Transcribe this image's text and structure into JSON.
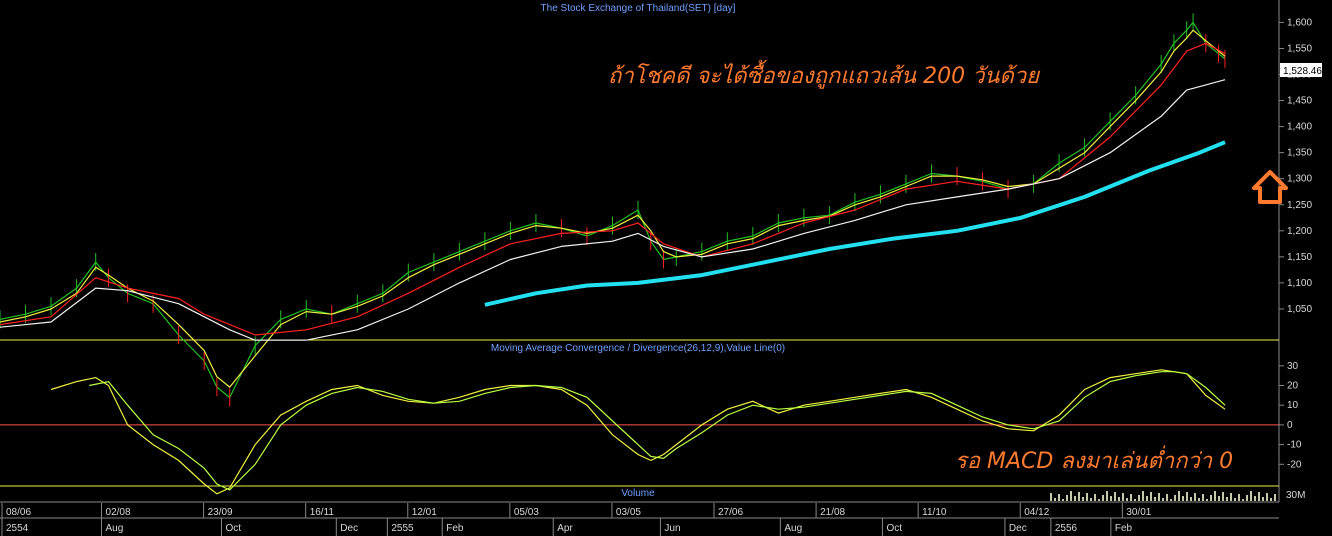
{
  "panels": {
    "price_title": "The Stock Exchange of Thailand(SET) [day]",
    "macd_title": "Moving Average Convergence / Divergence(26,12,9),Value Line(0)",
    "volume_title": "Volume"
  },
  "current_value_label": "1,528.46",
  "annotations": {
    "price_note": "ถ้าโชคดี จะได้ซื้อของถูกแถวเส้น 200 วันด้วย",
    "macd_note": "รอ MACD ลงมาเล่นต่ำกว่า 0"
  },
  "colors": {
    "annotation": "#ff7a2e",
    "ma200": "#22e0f0",
    "ma_white": "#f2f2f2",
    "ma_red": "#ff2020",
    "ma_yellow": "#f0f040",
    "candle_up": "#22c022",
    "candle_down": "#ff2020",
    "macd": "#f0f040",
    "signal": "#b8ff40",
    "zero_line": "#ff5050",
    "title": "#6fa0ff"
  },
  "chart_data": {
    "type": "line",
    "price_axis": {
      "ticks": [
        "1,600",
        "1,550",
        "1,500",
        "1,450",
        "1,400",
        "1,350",
        "1,300",
        "1,250",
        "1,200",
        "1,150",
        "1,100",
        "1,050"
      ],
      "tick_values": [
        1600,
        1550,
        1500,
        1450,
        1400,
        1350,
        1300,
        1250,
        1200,
        1150,
        1100,
        1050
      ],
      "range": [
        1000,
        1620
      ]
    },
    "macd_axis": {
      "ticks": [
        "30",
        "20",
        "10",
        "0",
        "-10",
        "-20"
      ],
      "tick_values": [
        30,
        20,
        10,
        0,
        -10,
        -20
      ],
      "range": [
        -30,
        36
      ]
    },
    "volume_axis": {
      "ticks": [
        "30M"
      ]
    },
    "date_labels_top": [
      "08/06",
      "02/08",
      "23/09",
      "16/11",
      "12/01",
      "05/03",
      "03/05",
      "27/06",
      "21/08",
      "11/10",
      "04/12",
      "30/01"
    ],
    "date_labels_bottom": [
      "2554",
      "Aug",
      "Oct",
      "Dec",
      "2555",
      "Feb",
      "Apr",
      "Jun",
      "Aug",
      "Oct",
      "Dec",
      "2556",
      "Feb"
    ],
    "date_top_pos": [
      0.0,
      0.078,
      0.158,
      0.238,
      0.318,
      0.398,
      0.478,
      0.558,
      0.638,
      0.718,
      0.798,
      0.878
    ],
    "date_bottom_pos": [
      0.0,
      0.078,
      0.172,
      0.262,
      0.302,
      0.345,
      0.432,
      0.516,
      0.61,
      0.69,
      0.786,
      0.822,
      0.869
    ],
    "price_series": [
      {
        "name": "SET close",
        "t": [
          0,
          0.02,
          0.04,
          0.06,
          0.075,
          0.085,
          0.1,
          0.12,
          0.14,
          0.16,
          0.17,
          0.18,
          0.2,
          0.22,
          0.24,
          0.26,
          0.28,
          0.3,
          0.32,
          0.34,
          0.36,
          0.38,
          0.4,
          0.42,
          0.44,
          0.46,
          0.48,
          0.5,
          0.51,
          0.52,
          0.53,
          0.55,
          0.57,
          0.59,
          0.61,
          0.63,
          0.65,
          0.67,
          0.69,
          0.71,
          0.73,
          0.75,
          0.77,
          0.79,
          0.81,
          0.83,
          0.85,
          0.87,
          0.89,
          0.91,
          0.92,
          0.93,
          0.935,
          0.945,
          0.955,
          0.96
        ],
        "v": [
          1030,
          1040,
          1055,
          1090,
          1140,
          1110,
          1080,
          1060,
          1000,
          950,
          900,
          880,
          980,
          1030,
          1050,
          1040,
          1060,
          1080,
          1120,
          1140,
          1160,
          1180,
          1200,
          1215,
          1205,
          1190,
          1210,
          1240,
          1180,
          1145,
          1150,
          1160,
          1180,
          1190,
          1215,
          1225,
          1230,
          1255,
          1270,
          1290,
          1310,
          1305,
          1295,
          1280,
          1290,
          1330,
          1360,
          1410,
          1460,
          1520,
          1560,
          1585,
          1600,
          1560,
          1540,
          1530
        ]
      },
      {
        "name": "Fast MA",
        "t": [
          0,
          0.02,
          0.04,
          0.06,
          0.075,
          0.085,
          0.1,
          0.12,
          0.14,
          0.16,
          0.17,
          0.18,
          0.2,
          0.22,
          0.24,
          0.26,
          0.28,
          0.3,
          0.32,
          0.34,
          0.36,
          0.38,
          0.4,
          0.42,
          0.44,
          0.46,
          0.48,
          0.5,
          0.51,
          0.52,
          0.53,
          0.55,
          0.57,
          0.59,
          0.61,
          0.63,
          0.65,
          0.67,
          0.69,
          0.71,
          0.73,
          0.75,
          0.77,
          0.79,
          0.81,
          0.83,
          0.85,
          0.87,
          0.89,
          0.91,
          0.92,
          0.93,
          0.935,
          0.945,
          0.955,
          0.96
        ],
        "v": [
          1025,
          1035,
          1050,
          1080,
          1130,
          1115,
          1090,
          1065,
          1020,
          970,
          920,
          900,
          960,
          1020,
          1045,
          1040,
          1055,
          1075,
          1110,
          1135,
          1155,
          1175,
          1195,
          1210,
          1205,
          1195,
          1205,
          1230,
          1200,
          1160,
          1150,
          1155,
          1175,
          1185,
          1210,
          1220,
          1228,
          1250,
          1265,
          1285,
          1305,
          1305,
          1298,
          1285,
          1290,
          1320,
          1350,
          1400,
          1450,
          1505,
          1545,
          1570,
          1585,
          1565,
          1545,
          1535
        ]
      },
      {
        "name": "MA red",
        "t": [
          0,
          0.04,
          0.075,
          0.1,
          0.14,
          0.16,
          0.2,
          0.24,
          0.28,
          0.32,
          0.36,
          0.4,
          0.44,
          0.48,
          0.5,
          0.52,
          0.55,
          0.59,
          0.63,
          0.67,
          0.71,
          0.75,
          0.79,
          0.83,
          0.87,
          0.91,
          0.93,
          0.945,
          0.96
        ],
        "v": [
          1020,
          1035,
          1110,
          1090,
          1070,
          1040,
          1000,
          1010,
          1035,
          1080,
          1130,
          1175,
          1195,
          1200,
          1215,
          1175,
          1150,
          1175,
          1215,
          1240,
          1280,
          1295,
          1280,
          1300,
          1380,
          1480,
          1545,
          1560,
          1540
        ]
      },
      {
        "name": "MA white",
        "t": [
          0,
          0.04,
          0.075,
          0.1,
          0.14,
          0.18,
          0.2,
          0.24,
          0.28,
          0.32,
          0.36,
          0.4,
          0.44,
          0.48,
          0.5,
          0.52,
          0.55,
          0.59,
          0.63,
          0.67,
          0.71,
          0.75,
          0.79,
          0.83,
          0.87,
          0.91,
          0.93,
          0.945,
          0.96
        ],
        "v": [
          1015,
          1025,
          1090,
          1085,
          1060,
          1010,
          990,
          990,
          1010,
          1050,
          1100,
          1145,
          1170,
          1180,
          1195,
          1170,
          1150,
          1165,
          1195,
          1220,
          1250,
          1265,
          1280,
          1300,
          1350,
          1420,
          1470,
          1480,
          1490
        ]
      },
      {
        "name": "MA 200",
        "t": [
          0.38,
          0.42,
          0.46,
          0.5,
          0.55,
          0.6,
          0.65,
          0.7,
          0.75,
          0.8,
          0.85,
          0.9,
          0.94,
          0.96
        ],
        "v": [
          1058,
          1080,
          1095,
          1100,
          1115,
          1140,
          1165,
          1185,
          1200,
          1225,
          1265,
          1315,
          1350,
          1370
        ]
      }
    ],
    "macd_series": [
      {
        "name": "MACD",
        "t": [
          0.04,
          0.06,
          0.075,
          0.085,
          0.1,
          0.12,
          0.14,
          0.16,
          0.17,
          0.18,
          0.2,
          0.22,
          0.24,
          0.26,
          0.28,
          0.3,
          0.32,
          0.34,
          0.36,
          0.38,
          0.4,
          0.42,
          0.44,
          0.46,
          0.48,
          0.5,
          0.51,
          0.52,
          0.53,
          0.55,
          0.57,
          0.59,
          0.61,
          0.63,
          0.65,
          0.67,
          0.69,
          0.71,
          0.73,
          0.75,
          0.77,
          0.79,
          0.81,
          0.83,
          0.85,
          0.87,
          0.89,
          0.91,
          0.92,
          0.93,
          0.945,
          0.96
        ],
        "v": [
          18,
          22,
          24,
          20,
          0,
          -10,
          -18,
          -30,
          -35,
          -32,
          -10,
          5,
          12,
          18,
          20,
          15,
          12,
          11,
          14,
          18,
          20,
          20,
          18,
          10,
          -5,
          -15,
          -18,
          -15,
          -10,
          0,
          8,
          12,
          6,
          10,
          12,
          14,
          16,
          18,
          14,
          8,
          2,
          -2,
          -3,
          5,
          18,
          24,
          26,
          28,
          27,
          26,
          15,
          8
        ]
      },
      {
        "name": "Signal",
        "t": [
          0.07,
          0.085,
          0.1,
          0.12,
          0.14,
          0.16,
          0.17,
          0.18,
          0.2,
          0.22,
          0.24,
          0.26,
          0.28,
          0.3,
          0.32,
          0.34,
          0.36,
          0.38,
          0.4,
          0.42,
          0.44,
          0.46,
          0.48,
          0.5,
          0.51,
          0.52,
          0.53,
          0.55,
          0.57,
          0.59,
          0.61,
          0.63,
          0.65,
          0.67,
          0.69,
          0.71,
          0.73,
          0.75,
          0.77,
          0.79,
          0.81,
          0.83,
          0.85,
          0.87,
          0.89,
          0.91,
          0.92,
          0.93,
          0.945,
          0.96
        ],
        "v": [
          20,
          22,
          10,
          -5,
          -12,
          -22,
          -30,
          -33,
          -20,
          0,
          10,
          16,
          19,
          17,
          13,
          11,
          12,
          16,
          19,
          20,
          19,
          14,
          2,
          -10,
          -16,
          -17,
          -12,
          -4,
          5,
          10,
          8,
          9,
          11,
          13,
          15,
          17,
          16,
          10,
          4,
          0,
          -2,
          2,
          14,
          22,
          25,
          27,
          27,
          26,
          19,
          10
        ]
      }
    ],
    "macd_zero_line": 0
  }
}
